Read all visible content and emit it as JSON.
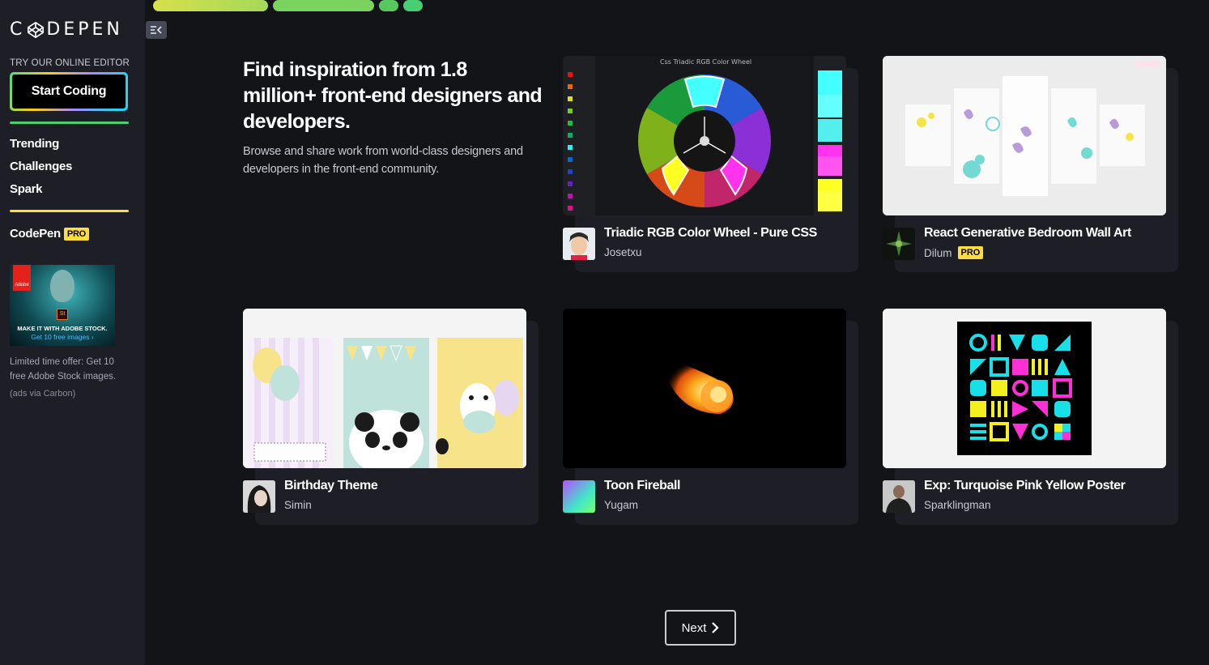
{
  "brand": {
    "logo_left": "C",
    "logo_right": "DEPEN"
  },
  "sidebar": {
    "try_label": "TRY OUR ONLINE EDITOR",
    "start_coding": "Start Coding",
    "nav": [
      {
        "label": "Trending"
      },
      {
        "label": "Challenges"
      },
      {
        "label": "Spark"
      }
    ],
    "codepen_label": "CodePen",
    "pro_badge": "PRO",
    "ad": {
      "line1": "MAKE IT WITH ADOBE STOCK.",
      "line2": "Get 10 free images ›",
      "adobe": "Adobe",
      "st": "St",
      "text": "Limited time offer: Get 10 free Adobe Stock images.",
      "via": "(ads via Carbon)"
    }
  },
  "hero": {
    "title": "Find inspiration from 1.8 million+ front-end designers and developers.",
    "subtitle": "Browse and share work from world-class designers and developers in the front-end community."
  },
  "cards": [
    {
      "title": "Triadic RGB Color Wheel - Pure CSS",
      "author": "Josetxu",
      "pro": false,
      "thumb_title": "Css Triadic RGB Color Wheel"
    },
    {
      "title": "React Generative Bedroom Wall Art",
      "author": "Dilum",
      "pro": true,
      "pro_label": "PRO"
    },
    {
      "title": "Birthday Theme",
      "author": "Simin",
      "pro": false
    },
    {
      "title": "Toon Fireball",
      "author": "Yugam",
      "pro": false
    },
    {
      "title": "Exp: Turquoise Pink Yellow Poster",
      "author": "Sparklingman",
      "pro": false
    }
  ],
  "pagination": {
    "next": "Next"
  },
  "colors": {
    "accent_green": "#47cf73",
    "accent_yellow": "#ffdd40",
    "sidebar_bg": "#1e1f26",
    "page_bg": "#131417"
  }
}
